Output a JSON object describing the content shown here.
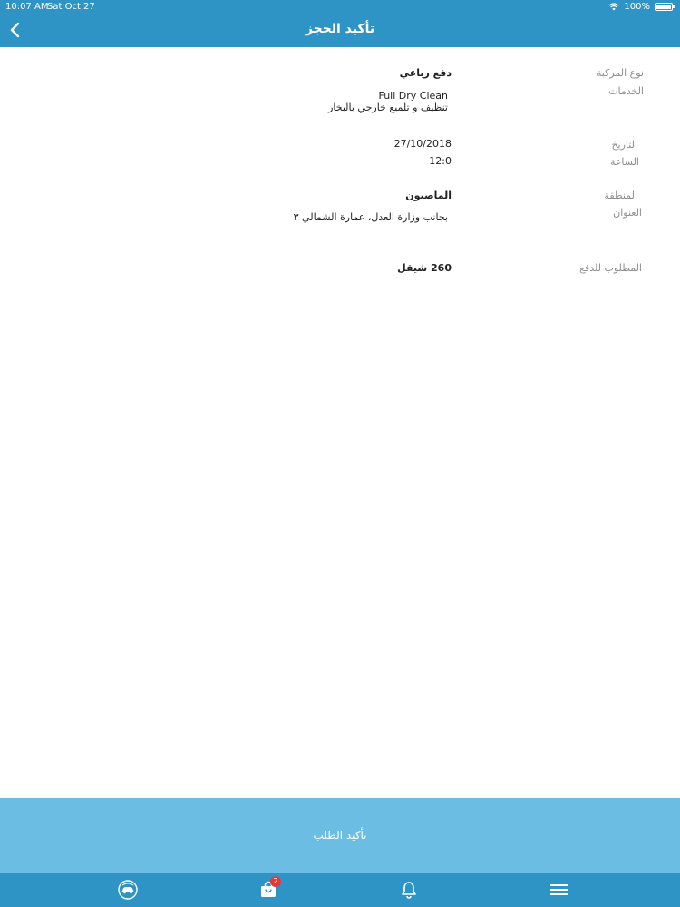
{
  "status_bar": {
    "time": "10:07 AM",
    "date": "Sat Oct 27",
    "battery": "100%"
  },
  "nav": {
    "title": "تأكيد الحجز"
  },
  "details": {
    "vehicle_type_label": "نوع المركبة",
    "vehicle_type_value": "دفع رباعي",
    "services_label": "الخدمات",
    "service_1": "Full Dry Clean",
    "service_2": "تنظيف و تلميع خارجي بالبخار",
    "date_label": "التاريخ",
    "date_value": "27/10/2018",
    "time_label": "الساعة",
    "time_value": "12:0",
    "area_label": "المنطقة",
    "area_value": "الماصيون",
    "address_label": "العنوان",
    "address_value": "بجانب وزارة العدل، عمارة الشمالي ٣",
    "amount_label": "المطلوب للدفع",
    "amount_value": "260 شيقل"
  },
  "confirm": {
    "label": "تأكيد الطلب"
  },
  "tab_bar": {
    "cart_badge": "2"
  },
  "colors": {
    "primary": "#2e94c6",
    "confirm_bar": "#6cbde3",
    "badge": "#e53935"
  }
}
